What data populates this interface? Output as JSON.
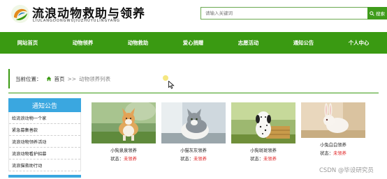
{
  "header": {
    "title": "流浪动物救助与领养",
    "subtitle": "LIULANGDONGWUJIUZHUYULINGYANG",
    "search": {
      "placeholder": "请输入关键词",
      "button_label": "搜索"
    }
  },
  "nav": {
    "items": [
      "网站首页",
      "动物领养",
      "动物救助",
      "爱心捐赠",
      "志愿活动",
      "通知公告",
      "个人中心"
    ]
  },
  "breadcrumb": {
    "label": "当前位置：",
    "home": "首页",
    "separator": ">>",
    "current": "动物领养列表"
  },
  "notice": {
    "title": "通知公告",
    "items": [
      "给流浪动物一个家",
      "紧急募集善款",
      "流浪动物领养活动",
      "流浪动物看护招募",
      "流浪猫救助行动"
    ]
  },
  "cards": [
    {
      "name": "小狗泉泉领养",
      "status_label": "状态：",
      "status_value": "未领养"
    },
    {
      "name": "小猫灰灰领养",
      "status_label": "状态：",
      "status_value": "未领养"
    },
    {
      "name": "小狗斑斑领养",
      "status_label": "状态：",
      "status_value": "未领养"
    },
    {
      "name": "小兔白白领养",
      "status_label": "状态：",
      "status_value": "未领养"
    }
  ],
  "watermark": "CSDN @毕设研究员",
  "colors": {
    "nav_green": "#3a9a12",
    "notice_blue": "#3aa7e0",
    "status_red": "#e02020"
  },
  "icons": {
    "home": "home-icon",
    "search": "search-icon",
    "logo": "logo-swirl-icon"
  }
}
